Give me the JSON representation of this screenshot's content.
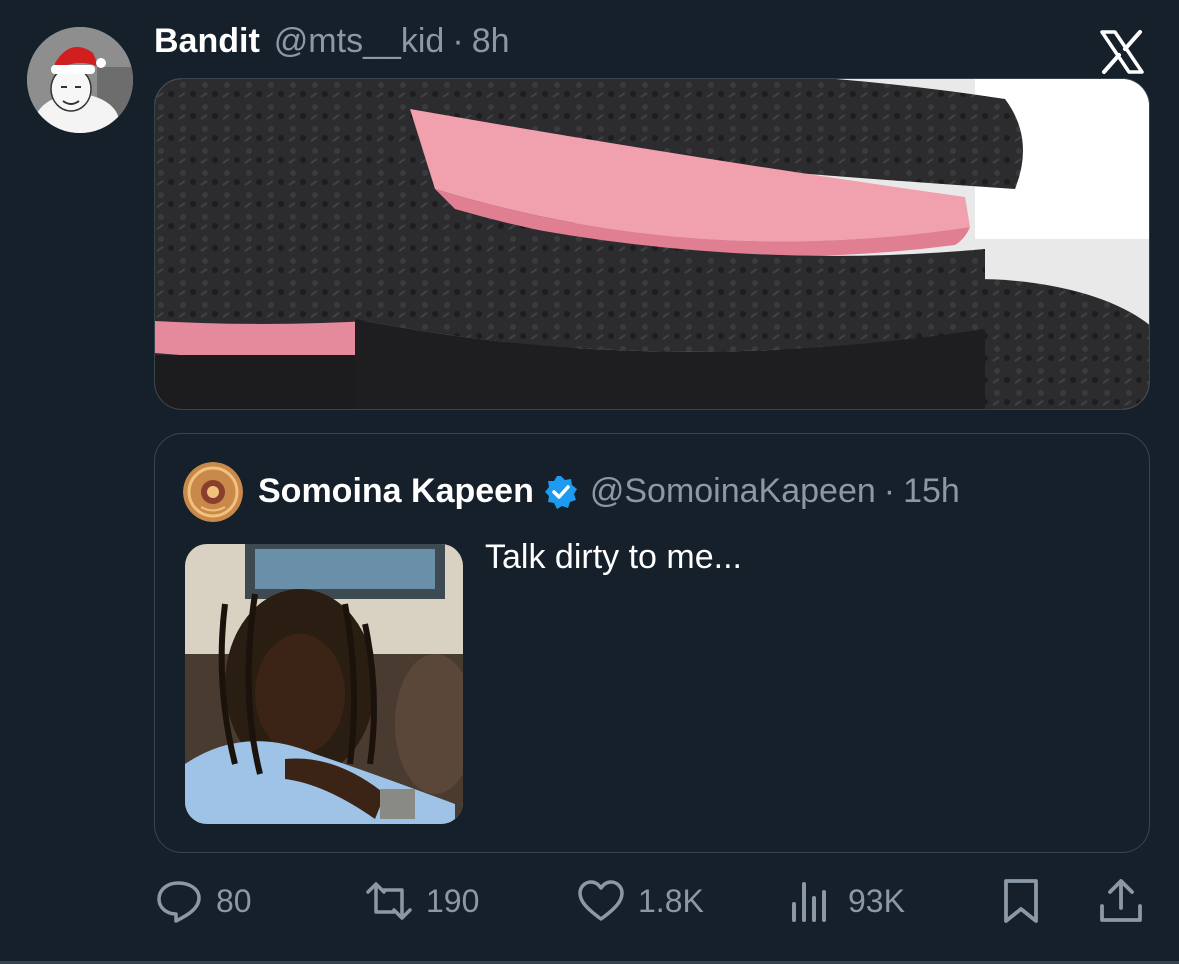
{
  "tweet": {
    "name": "Bandit",
    "handle": "@mts__kid",
    "separator": "·",
    "time": "8h"
  },
  "quoted": {
    "name": "Somoina Kapeen",
    "handle": "@SomoinaKapeen",
    "separator": "·",
    "time": "15h",
    "text": "Talk dirty to me..."
  },
  "actions": {
    "replies": "80",
    "reposts": "190",
    "likes": "1.8K",
    "views": "93K"
  },
  "colors": {
    "background": "#15202b",
    "secondary_text": "#8b98a5",
    "verified": "#1d9bf0",
    "border": "#38444d"
  },
  "icons": [
    "x-logo-icon",
    "verified-badge-icon",
    "reply-icon",
    "repost-icon",
    "like-icon",
    "views-icon",
    "bookmark-icon",
    "share-icon"
  ]
}
